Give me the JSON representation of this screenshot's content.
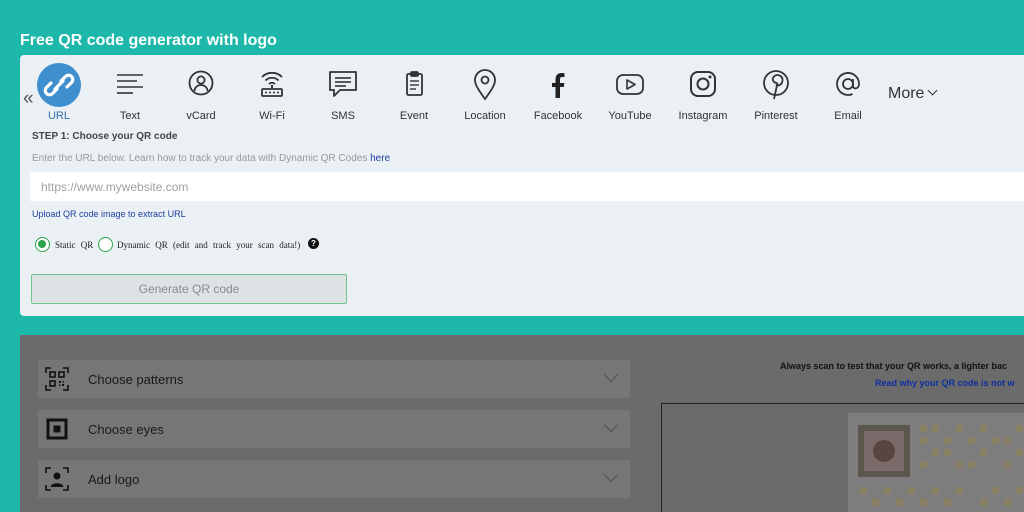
{
  "page": {
    "title": "Free QR code generator with logo"
  },
  "type_bar": {
    "items": [
      {
        "id": "url",
        "label": "URL",
        "icon": "link-icon",
        "active": true
      },
      {
        "id": "text",
        "label": "Text",
        "icon": "text-lines-icon"
      },
      {
        "id": "vcard",
        "label": "vCard",
        "icon": "person-icon"
      },
      {
        "id": "wifi",
        "label": "Wi-Fi",
        "icon": "wifi-icon"
      },
      {
        "id": "sms",
        "label": "SMS",
        "icon": "chat-bubble-icon"
      },
      {
        "id": "event",
        "label": "Event",
        "icon": "clipboard-icon"
      },
      {
        "id": "location",
        "label": "Location",
        "icon": "map-pin-icon"
      },
      {
        "id": "facebook",
        "label": "Facebook",
        "icon": "facebook-icon"
      },
      {
        "id": "youtube",
        "label": "YouTube",
        "icon": "youtube-icon"
      },
      {
        "id": "instagram",
        "label": "Instagram",
        "icon": "instagram-icon"
      },
      {
        "id": "pinterest",
        "label": "Pinterest",
        "icon": "pinterest-icon"
      },
      {
        "id": "email",
        "label": "Email",
        "icon": "at-sign-icon"
      }
    ],
    "more_label": "More"
  },
  "step": {
    "title": "STEP 1: Choose your QR code",
    "hint": "Enter the URL below. Learn how to track your data with Dynamic QR Codes ",
    "hint_link": "here",
    "url_placeholder": "https://www.mywebsite.com",
    "upload_link": "Upload QR code image to extract URL"
  },
  "qr_mode": {
    "static_label": "Static QR",
    "dynamic_label": "Dynamic QR (edit and track your scan data!)",
    "selected": "static"
  },
  "generate_button": "Generate QR code",
  "design": {
    "sections": [
      {
        "label": "Choose patterns",
        "icon": "qr-pattern-icon"
      },
      {
        "label": "Choose eyes",
        "icon": "qr-eye-icon"
      },
      {
        "label": "Add logo",
        "icon": "add-logo-icon"
      }
    ],
    "scan_note": "Always scan to test that your QR works, a lighter bac",
    "read_link": "Read why your QR code is not w"
  },
  "colors": {
    "background": "#1db8a9",
    "card": "#ebf0f4",
    "active_icon": "#3f8fcf",
    "radio_green": "#2aa34a",
    "link_blue": "#1b3fa0",
    "overlay": "#6b6b6b"
  }
}
